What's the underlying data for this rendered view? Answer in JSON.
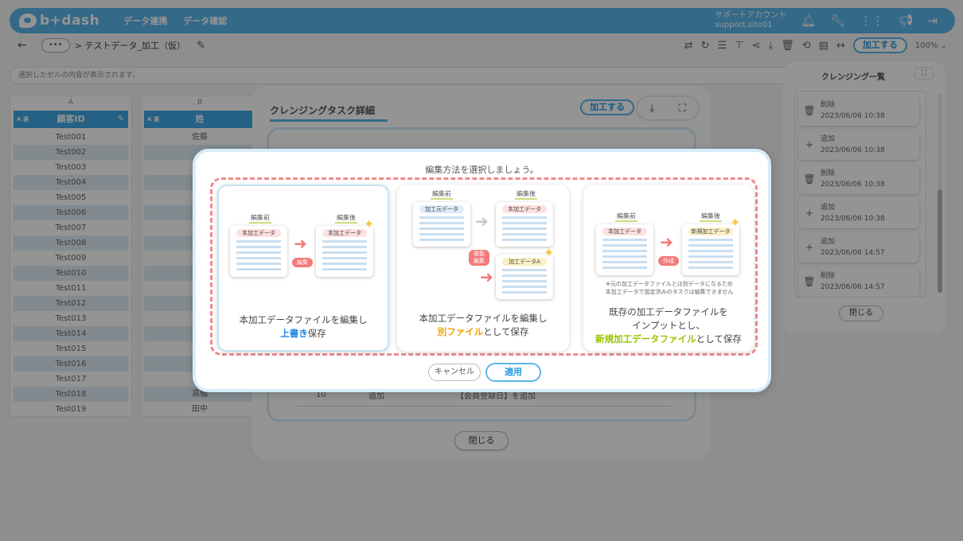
{
  "header": {
    "logo": "b+dash",
    "nav": [
      "データ連携",
      "データ確認"
    ],
    "account_line1": "サポートアカウント",
    "account_line2": "support.site01"
  },
  "toolbar": {
    "back": "←",
    "crumb_dots": "•••",
    "breadcrumb": "> テストデータ_加工（仮）",
    "process_button": "加工する",
    "zoom": "100%"
  },
  "cell_display": "選択したセルの内容が表示されます。",
  "grid": {
    "col_a_letter": "A",
    "col_b_letter": "B",
    "col_a_header": "顧客ID",
    "col_b_header": "姓",
    "tag": "A 選",
    "col_a_cells": [
      "Test001",
      "Test002",
      "Test003",
      "Test004",
      "Test005",
      "Test006",
      "Test007",
      "Test008",
      "Test009",
      "Test010",
      "Test011",
      "Test012",
      "Test013",
      "Test014",
      "Test015",
      "Test016",
      "Test017",
      "Test018",
      "Test019"
    ],
    "col_b_cells": [
      "佐藤",
      "",
      "",
      "",
      "",
      "",
      "",
      "",
      "",
      "",
      "",
      "",
      "",
      "",
      "",
      "",
      "",
      "高橋",
      "田中"
    ]
  },
  "task_modal": {
    "title": "クレンジングタスク詳細",
    "process_button": "加工する",
    "row_no": "10",
    "row_kind": "追加",
    "row_desc": "【会員登録日】を追加",
    "close": "閉じる"
  },
  "list_panel": {
    "title": "クレンジング一覧",
    "items": [
      {
        "action": "削除",
        "date": "2023/06/06 10:38",
        "icon": "trash-icon"
      },
      {
        "action": "追加",
        "date": "2023/06/06 10:38",
        "icon": "plus-icon"
      },
      {
        "action": "削除",
        "date": "2023/06/06 10:38",
        "icon": "trash-icon"
      },
      {
        "action": "追加",
        "date": "2023/06/06 10:38",
        "icon": "plus-icon"
      },
      {
        "action": "追加",
        "date": "2023/06/06 14:57",
        "icon": "plus-icon"
      },
      {
        "action": "削除",
        "date": "2023/06/06 14:57",
        "icon": "trash-icon"
      }
    ],
    "close": "閉じる"
  },
  "dialog": {
    "prompt": "編集方法を選択しましょう。",
    "before": "編集前",
    "after": "編集後",
    "card1": {
      "sheet": "本加工データ",
      "tag": "編集",
      "line1": "本加工データファイルを編集し",
      "highlight": "上書き",
      "tail": "保存"
    },
    "card2": {
      "src_sheet": "加工元データ",
      "dst_sheet": "本加工データ",
      "copy_sheet": "加工データA",
      "tag1": "複製",
      "tag2": "編集",
      "line1": "本加工データファイルを編集し",
      "highlight": "別ファイル",
      "tail": "として保存"
    },
    "card3": {
      "src_sheet": "本加工データ",
      "dst_sheet": "新規加工データ",
      "tag": "作成",
      "note1": "※元の加工データファイルとは別データになるため",
      "note2": "本加工データで設定済みのタスクは編集できません",
      "line1": "既存の加工データファイルを",
      "line2": "インプットとし、",
      "highlight": "新規加工データファイル",
      "tail": "として保存"
    },
    "cancel": "キャンセル",
    "apply": "適用"
  },
  "colors": {
    "brand": "#5bb6ea",
    "dash": "#f08a8a",
    "highlight_blue": "#1e88e5",
    "highlight_orange": "#f0a400",
    "highlight_lime": "#9ac400"
  }
}
